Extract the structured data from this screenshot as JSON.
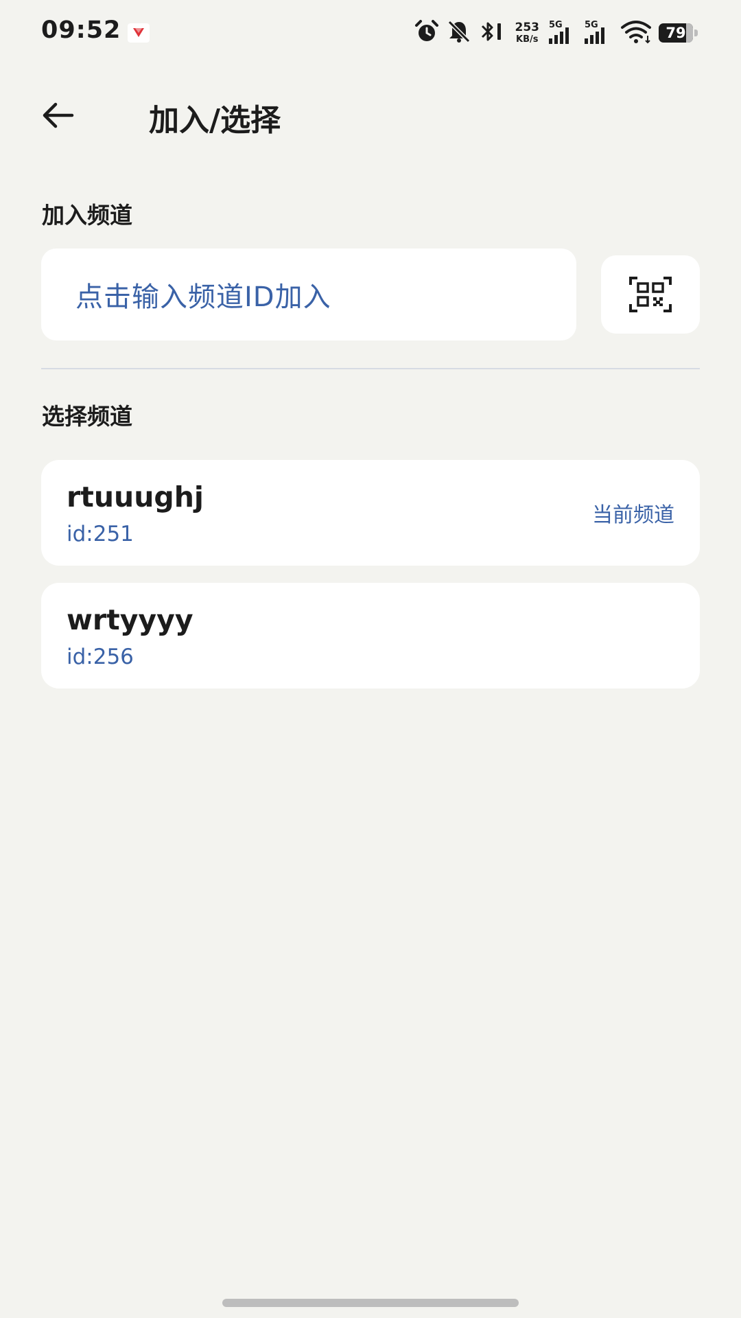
{
  "status_bar": {
    "time": "09:52",
    "net_speed_value": "253",
    "net_speed_unit": "KB/s",
    "sim1_tag": "5G",
    "sim2_tag": "5G",
    "battery_level": "79",
    "battery_fraction": 0.79,
    "icons": [
      "app-notification-icon",
      "alarm-icon",
      "bell-off-icon",
      "bluetooth-icon",
      "signal-icon",
      "wifi-icon",
      "battery-icon"
    ]
  },
  "header": {
    "back_icon": "arrow-left-icon",
    "title": "加入/选择"
  },
  "join_section": {
    "label": "加入频道",
    "input_placeholder": "点击输入频道ID加入",
    "scan_icon": "qr-scan-icon"
  },
  "select_section": {
    "label": "选择频道",
    "channels": [
      {
        "name": "rtuuughj",
        "id": "id:251",
        "badge": "当前频道"
      },
      {
        "name": "wrtyyyy",
        "id": "id:256",
        "badge": ""
      }
    ]
  },
  "colors": {
    "background": "#f3f3ef",
    "card": "#ffffff",
    "accent_text": "#3a62a7",
    "primary_text": "#1c1c1c",
    "divider": "#d6dbe3"
  }
}
